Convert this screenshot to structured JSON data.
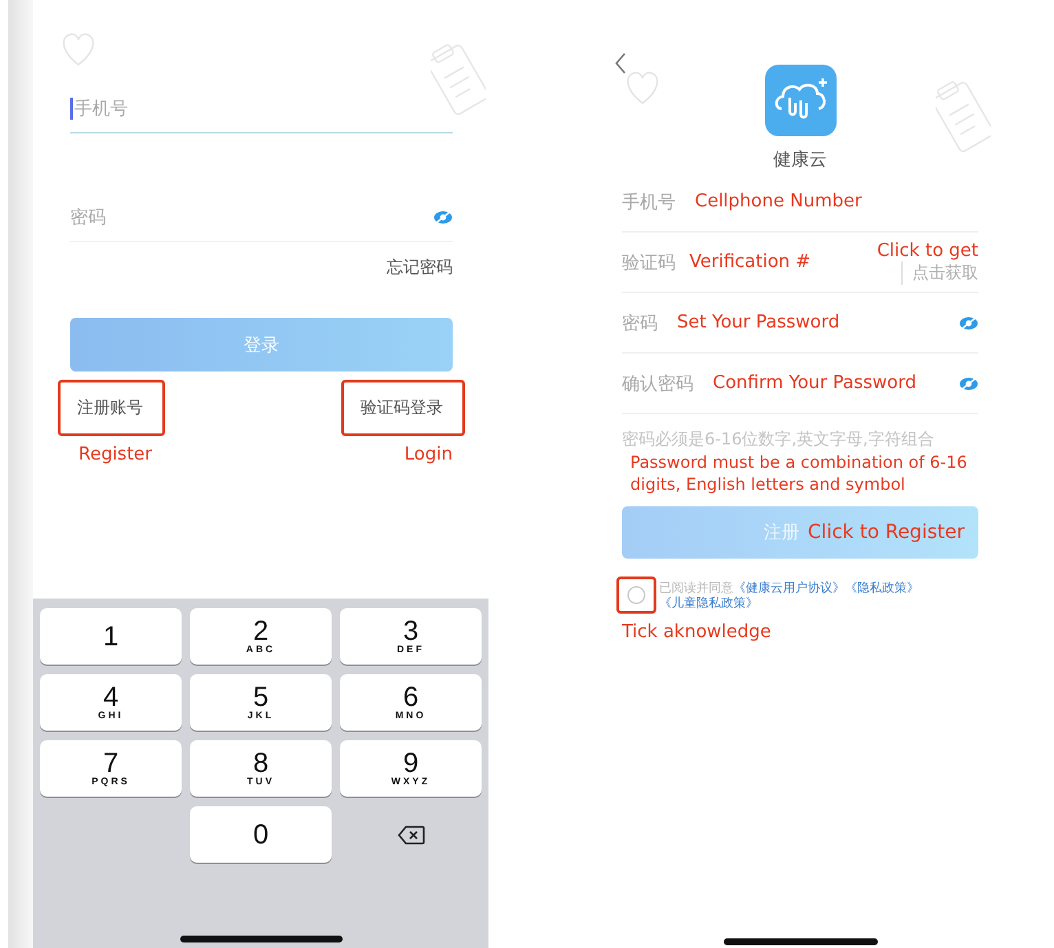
{
  "login_screen": {
    "phone_field": {
      "placeholder": "手机号"
    },
    "password_field": {
      "label": "密码"
    },
    "forgot_password": "忘记密码",
    "login_button": "登录",
    "register_link": {
      "label": "注册账号",
      "annotation": "Register"
    },
    "code_login_link": {
      "label": "验证码登录",
      "annotation": "Login"
    }
  },
  "keypad": {
    "keys": [
      {
        "kind": "digit",
        "digit": "1"
      },
      {
        "kind": "digit",
        "digit": "2",
        "letters": "ABC"
      },
      {
        "kind": "digit",
        "digit": "3",
        "letters": "DEF"
      },
      {
        "kind": "digit",
        "digit": "4",
        "letters": "GHI"
      },
      {
        "kind": "digit",
        "digit": "5",
        "letters": "JKL"
      },
      {
        "kind": "digit",
        "digit": "6",
        "letters": "MNO"
      },
      {
        "kind": "digit",
        "digit": "7",
        "letters": "PQRS"
      },
      {
        "kind": "digit",
        "digit": "8",
        "letters": "TUV"
      },
      {
        "kind": "digit",
        "digit": "9",
        "letters": "WXYZ"
      },
      {
        "kind": "blank"
      },
      {
        "kind": "digit",
        "digit": "0"
      },
      {
        "kind": "delete"
      }
    ]
  },
  "register_screen": {
    "app_name": "健康云",
    "fields": [
      {
        "kind": "text",
        "label": "手机号",
        "annotation": "Cellphone Number"
      },
      {
        "kind": "code",
        "label": "验证码",
        "annotation": "Verification #",
        "action": "点击获取",
        "action_annotation": "Click to get"
      },
      {
        "kind": "password",
        "label": "密码",
        "annotation": "Set Your Password"
      },
      {
        "kind": "password",
        "label": "确认密码",
        "annotation": "Confirm Your Password"
      }
    ],
    "hint": "密码必须是6-16位数字,英文字母,字符组合",
    "hint_annotation": "Password must be a combination of 6-16 digits, English letters and symbol",
    "register_button": {
      "label": "注册",
      "annotation": "Click to Register"
    },
    "agreement": {
      "checked": false,
      "text": "已阅读并同意",
      "links": [
        "《健康云用户协议》",
        "《隐私政策》",
        "《儿童隐私政策》"
      ],
      "annotation": "Tick aknowledge"
    }
  }
}
